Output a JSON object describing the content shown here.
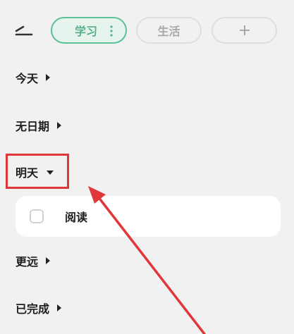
{
  "topbar": {
    "menu_icon": "hamburger-icon",
    "chips": [
      {
        "label": "学习",
        "selected": true,
        "accent": "#5bbf97"
      },
      {
        "label": "生活",
        "selected": false
      },
      {
        "label": "+",
        "selected": false
      }
    ],
    "study_more_icon": "more-vertical-icon"
  },
  "sections": {
    "today": {
      "label": "今天",
      "expanded": false
    },
    "no_date": {
      "label": "无日期",
      "expanded": false
    },
    "tomorrow": {
      "label": "明天",
      "expanded": true
    },
    "later": {
      "label": "更远",
      "expanded": false
    },
    "done": {
      "label": "已完成",
      "expanded": false
    }
  },
  "tasks_tomorrow": [
    {
      "label": "阅读",
      "checked": false
    }
  ],
  "annotation": {
    "highlight_color": "#e0373a",
    "highlights": "明天",
    "arrow_icon": "annotation-arrow-icon"
  }
}
